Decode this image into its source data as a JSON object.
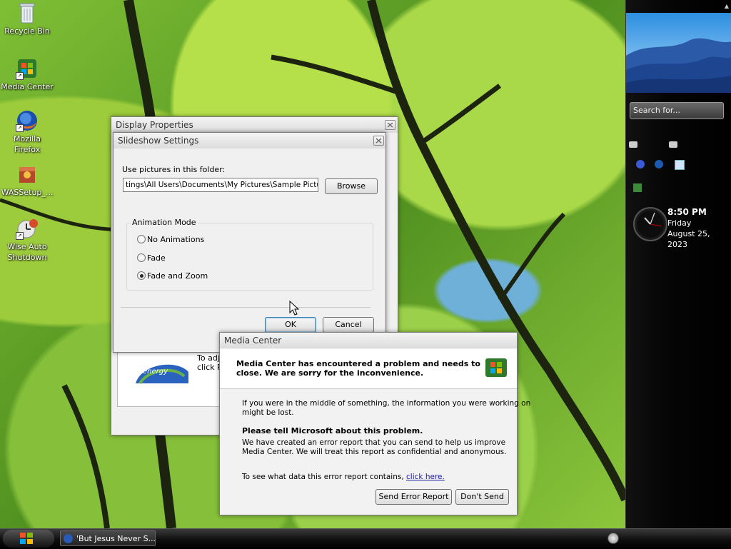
{
  "desktop": {
    "icons": [
      {
        "label": "Recycle Bin",
        "icon": "recycle-bin-icon"
      },
      {
        "label": "Media Center",
        "icon": "media-center-icon"
      },
      {
        "label": "Mozilla Firefox",
        "icon": "firefox-icon"
      },
      {
        "label": "WASSetup_...",
        "icon": "wassetup-icon"
      },
      {
        "label": "Wise Auto Shutdown",
        "icon": "wise-auto-shutdown-icon"
      }
    ]
  },
  "sidebar": {
    "search_placeholder": "Search for...",
    "time": "8:50 PM",
    "day": "Friday",
    "date": "August 25, 2023"
  },
  "display_properties": {
    "title": "Display Properties",
    "body_text_line1": "To adj",
    "body_text_line2": "click P",
    "energy_label": "energy"
  },
  "slideshow": {
    "title": "Slideshow Settings",
    "folder_label": "Use pictures in this folder:",
    "folder_value": "tings\\All Users\\Documents\\My Pictures\\Sample Pictures",
    "browse_label": "Browse",
    "animation_group": "Animation Mode",
    "options": [
      {
        "label": "No Animations",
        "selected": false
      },
      {
        "label": "Fade",
        "selected": false
      },
      {
        "label": "Fade and Zoom",
        "selected": true
      }
    ],
    "ok_label": "OK",
    "cancel_label": "Cancel"
  },
  "error_dialog": {
    "title": "Media Center",
    "heading_line1": "Media Center has encountered a problem and needs to",
    "heading_line2": "close.  We are sorry for the inconvenience.",
    "middle_line1": "If you were in the middle of something, the information you were working on",
    "middle_line2": "might be lost.",
    "tell_heading": "Please tell Microsoft about this problem.",
    "report_line1": "We have created an error report that you can send to help us improve",
    "report_line2": "Media Center.  We will treat this report as confidential and anonymous.",
    "see_data_text": "To see what data this error report contains,",
    "click_here": "click here.",
    "send_label": "Send Error Report",
    "dont_send_label": "Don't Send"
  },
  "taskbar": {
    "item_label": "'But Jesus Never S..."
  },
  "colors": {
    "link": "#1a1aa8",
    "ok_border": "#3c7fb1"
  }
}
